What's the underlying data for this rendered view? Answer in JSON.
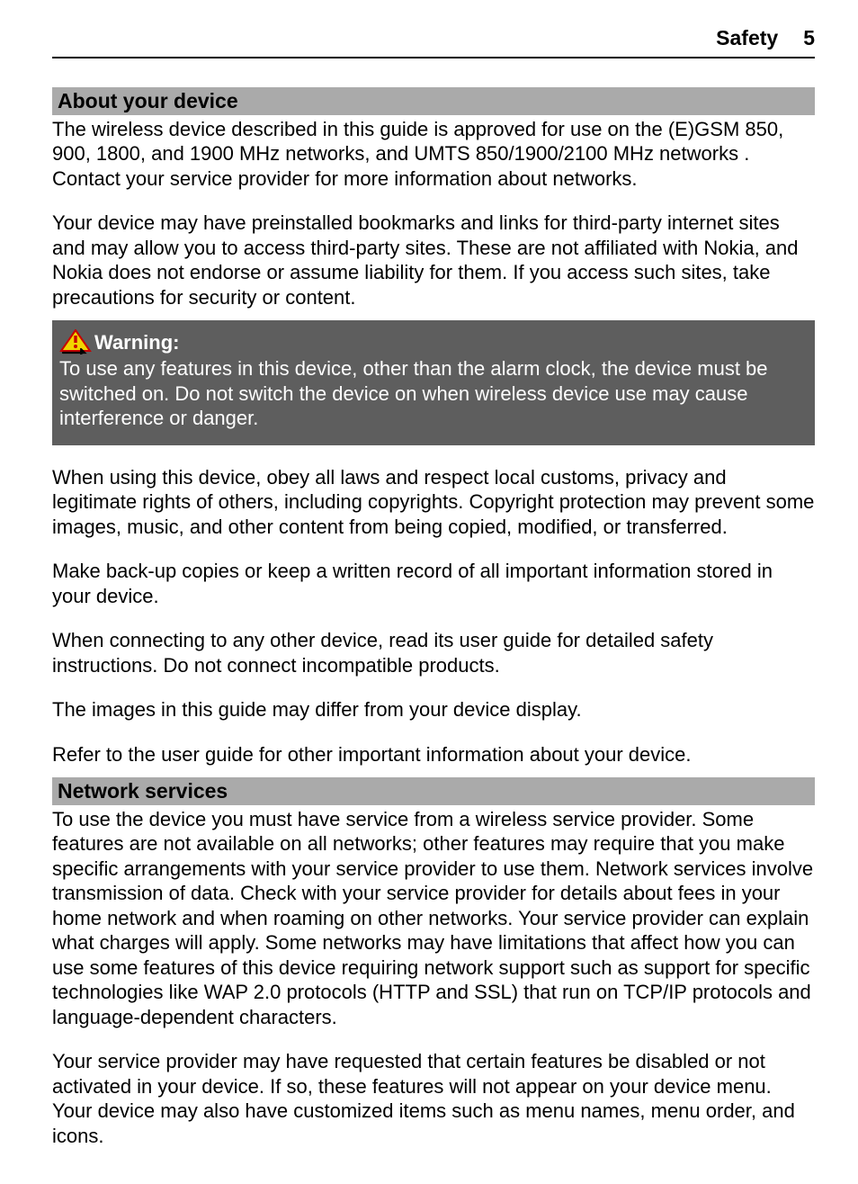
{
  "header": {
    "title": "Safety",
    "page": "5"
  },
  "sections": {
    "about": {
      "title": "About your device",
      "p1": "The wireless device described in this guide is approved for use on the (E)GSM 850, 900, 1800, and 1900 MHz networks, and UMTS 850/1900/2100 MHz networks . Contact your service provider for more information about networks.",
      "p2": "Your device may have preinstalled bookmarks and links for third-party internet sites and may allow you to access third-party sites. These are not affiliated with Nokia, and Nokia does not endorse or assume liability for them. If you access such sites, take precautions for security or content."
    },
    "warning": {
      "label": "Warning:",
      "text": "To use any features in this device, other than the alarm clock, the device must be switched on. Do not switch the device on when wireless device use may cause interference or danger."
    },
    "after_warning": {
      "p1": "When using this device, obey all laws and respect local customs, privacy and legitimate rights of others, including copyrights. Copyright protection may prevent some images, music, and other content from being copied, modified, or transferred.",
      "p2": "Make back-up copies or keep a written record of all important information stored in your device.",
      "p3": "When connecting to any other device, read its user guide for detailed safety instructions. Do not connect incompatible products.",
      "p4": "The images in this guide may differ from your device display.",
      "p5": "Refer to the user guide for other important information about your device."
    },
    "network": {
      "title": "Network services",
      "p1": "To use the device you must have service from a wireless service provider. Some features are not available on all networks; other features may require that you make specific arrangements with your service provider to use them. Network services involve transmission of data. Check with your service provider for details about fees in your home network and when roaming on other networks. Your service provider can explain what charges will apply. Some networks may have limitations that affect how you can use some features of this device requiring network support such as support for specific technologies like WAP 2.0 protocols (HTTP and SSL) that run on TCP/IP protocols and language-dependent characters.",
      "p2": "Your service provider may have requested that certain features be disabled or not activated in your device. If so, these features will not appear on your device menu. Your device may also have customized items such as menu names, menu order, and icons."
    }
  }
}
